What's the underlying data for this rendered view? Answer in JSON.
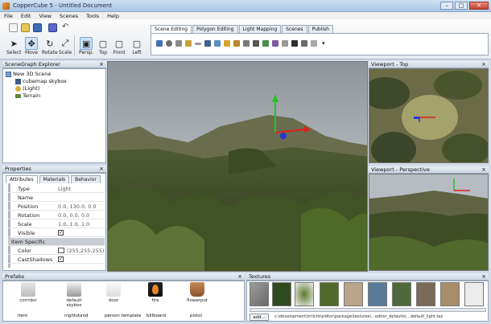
{
  "window": {
    "title": "CopperCube 5 - Untitled Document"
  },
  "menu": [
    "File",
    "Edit",
    "View",
    "Scenes",
    "Tools",
    "Help"
  ],
  "toolbar": {
    "tools": [
      "Select",
      "Move",
      "Rotate",
      "Scale"
    ],
    "views": [
      "Persp.",
      "Top",
      "Front",
      "Left"
    ]
  },
  "ribbon_tabs": [
    "Scene Editing",
    "Polygon Editing",
    "Light Mapping",
    "Scenes",
    "Publish"
  ],
  "scenegraph": {
    "title": "SceneGraph Explorer",
    "items": [
      "New 3D Scene",
      "skybox",
      "(Light)",
      "Terrain"
    ],
    "item_1_prefix": "cubemap"
  },
  "viewports": {
    "main": "",
    "top": "Viewport - Top",
    "persp": "Viewport - Perspective"
  },
  "properties": {
    "title": "Properties",
    "tabs": [
      "Attributes",
      "Materials",
      "Behavior"
    ],
    "rows": [
      {
        "k": "Type",
        "v": "Light"
      },
      {
        "k": "Name",
        "v": ""
      },
      {
        "k": "Position",
        "v": "0.0, 130.0, 0.0"
      },
      {
        "k": "Rotation",
        "v": "0.0, 0.0, 0.0"
      },
      {
        "k": "Scale",
        "v": "1.0, 1.0, 1.0"
      }
    ],
    "visible_label": "Visible",
    "section": "Item Specific",
    "color_label": "Color",
    "color_value": "(255,255,255)",
    "shadows_label": "CastShadows"
  },
  "prefabs": {
    "title": "Prefabs",
    "items": [
      "corridor",
      "default skybox",
      "door",
      "fire",
      "flowerpot"
    ],
    "row2": [
      "item",
      "nightstand",
      "person template",
      "billboard",
      "pistol"
    ]
  },
  "textures": {
    "title": "Textures",
    "add": "add...",
    "path": "c:\\development\\irrlicht\\editor\\package\\textures\\...editor_defaults\\...default_light.tex"
  }
}
